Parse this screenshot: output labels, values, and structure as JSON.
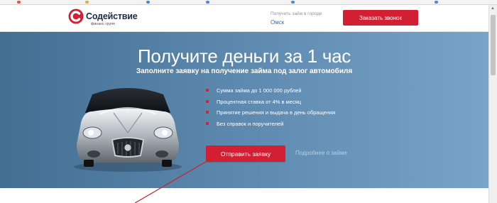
{
  "header": {
    "logo_name": "Содействие",
    "logo_sub": "финанс групп",
    "city_label": "Получить займ в городе",
    "city_value": "Омск",
    "call_button": "Заказать звонок"
  },
  "hero": {
    "title": "Получите деньги за 1 час",
    "subtitle": "Заполните заявку на получение займа под залог автомобиля",
    "features": [
      "Сумма займа до 1 000 000 рублей",
      "Процентная ставка от 4% в месяц",
      "Принятие решения и выдача в день обращения",
      "Без справок и поручителей"
    ],
    "apply_button": "Отправить заявку",
    "more_link": "Подробнее о займе"
  },
  "colors": {
    "accent_red": "#d21f34",
    "hero_blue_left": "#436e92",
    "hero_blue_right": "#79a4c9",
    "link_blue": "#2f6fb0"
  },
  "icons": {
    "logo": "brand-c-logo-icon",
    "bullet": "red-square-bullet-icon",
    "car": "silver-jaguar-car-image",
    "annotation": "red-annotation-arrow"
  }
}
